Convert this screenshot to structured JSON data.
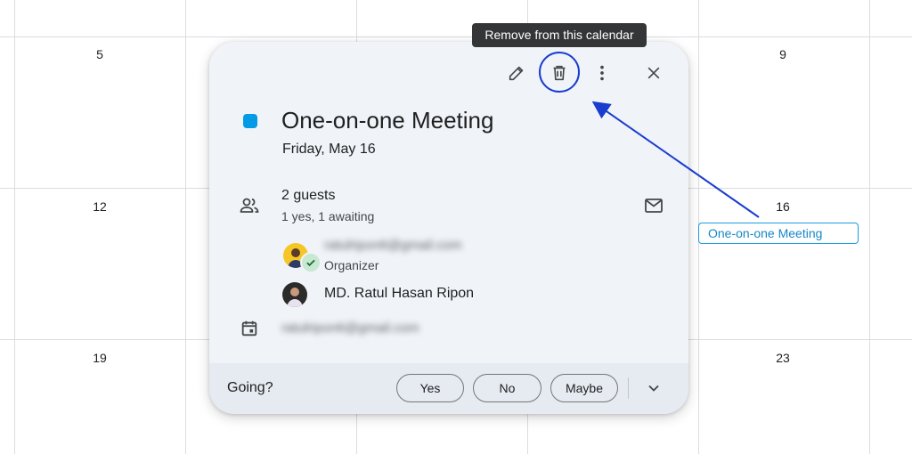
{
  "calendar": {
    "days": {
      "d5": "5",
      "d9": "9",
      "d12": "12",
      "d16": "16",
      "d19": "19",
      "d23": "23"
    },
    "event_chip": "One-on-one Meeting"
  },
  "tooltip": "Remove from this calendar",
  "popup": {
    "toolbar": {
      "edit_icon": "pencil-icon",
      "delete_icon": "trash-icon",
      "more_icon": "more-vert-icon",
      "close_icon": "close-icon"
    },
    "event_color": "#039be5",
    "title": "One-on-one Meeting",
    "date": "Friday, May 16",
    "guests_count": "2 guests",
    "guests_status": "1 yes, 1 awaiting",
    "guests": [
      {
        "email": "ratulripon6@gmail.com",
        "role": "Organizer"
      },
      {
        "name": "MD. Ratul Hasan Ripon"
      }
    ],
    "calendar_owner": "ratulripon6@gmail.com",
    "rsvp": {
      "prompt": "Going?",
      "yes": "Yes",
      "no": "No",
      "maybe": "Maybe"
    }
  },
  "colors": {
    "accent_blue": "#1a3ccf",
    "chip_border": "#1a9be0",
    "card_bg": "#f0f4f9"
  }
}
